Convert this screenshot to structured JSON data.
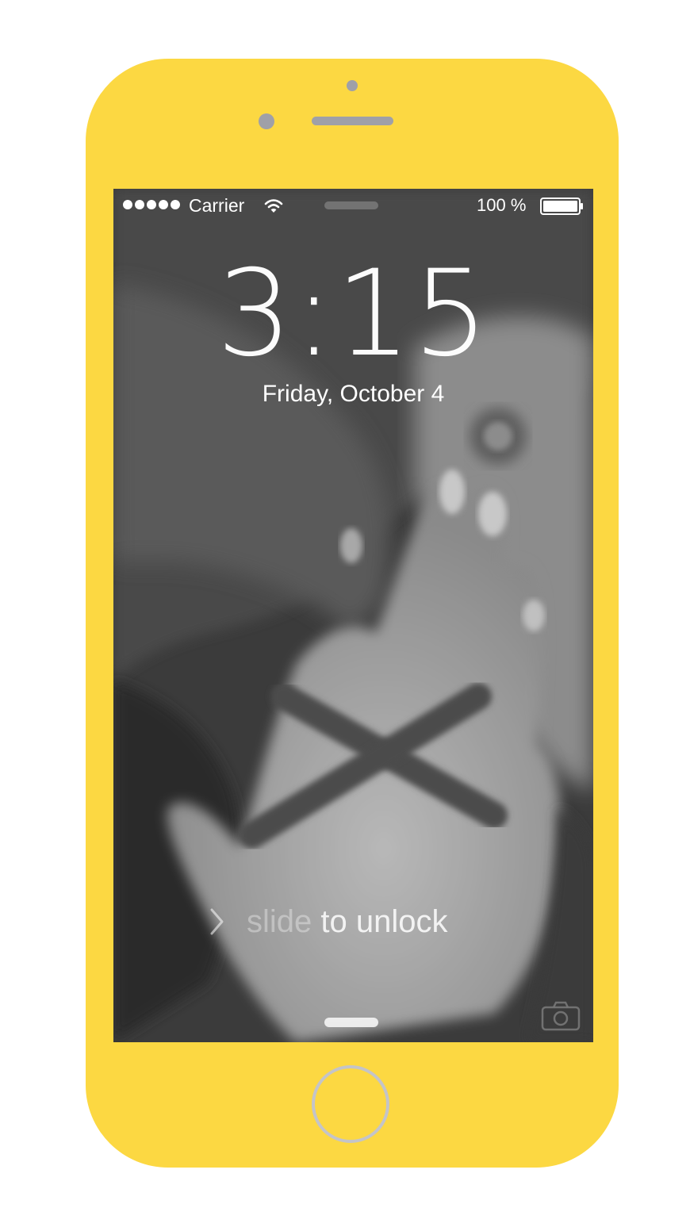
{
  "status_bar": {
    "signal_dots": 5,
    "carrier": "Carrier",
    "battery_percent": "100 %",
    "battery_level": 1.0,
    "icons": [
      "wifi-icon",
      "battery-icon"
    ]
  },
  "lock_screen": {
    "time": "3:15",
    "date": "Friday, October 4",
    "slide_prefix": "slide",
    "slide_rest": " to unlock",
    "icons": [
      "chevron-right-icon",
      "camera-icon"
    ]
  },
  "device": {
    "body_color": "#FCD842",
    "accent_gray": "#9fa0a8",
    "home_button_ring": "#c4c4c8"
  }
}
